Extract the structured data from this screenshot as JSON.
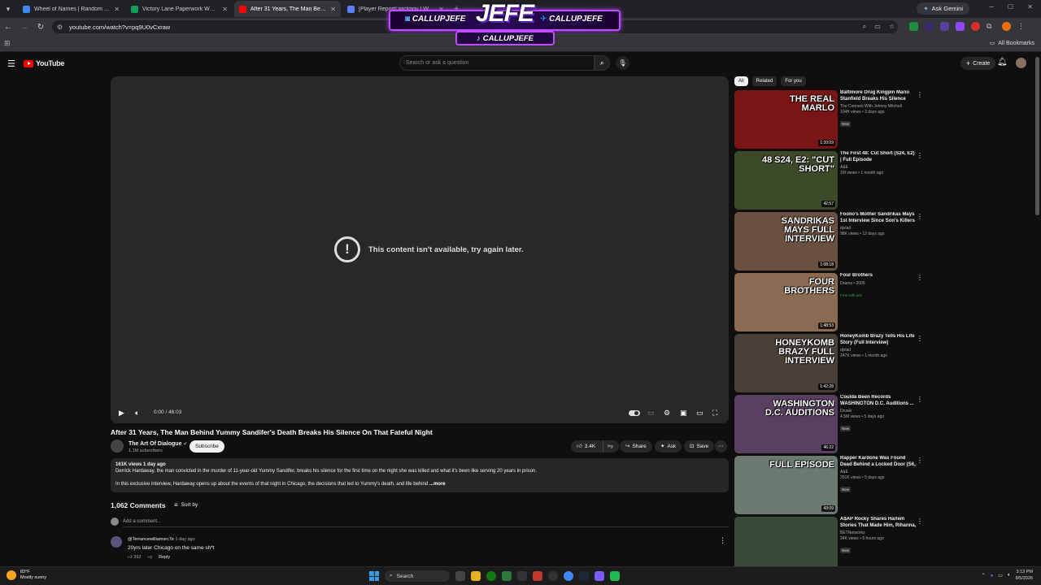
{
  "browser": {
    "tabs": [
      {
        "title": "Wheel of Names | Random name",
        "color": "#4285f4",
        "active": false
      },
      {
        "title": "Victory Lane Paperwork WCRP",
        "color": "#0f9d58",
        "active": false
      },
      {
        "title": "After 31 Years, The Man Behind",
        "color": "#ff0000",
        "active": true
      },
      {
        "title": "[Player Report] wickpov | Windy",
        "color": "#5c7cfa",
        "active": false
      }
    ],
    "new_tab_icon": "+",
    "ask_gemini": "Ask Gemini",
    "url": "youtube.com/watch?v=pq9U0vCxraw",
    "all_bookmarks": "All Bookmarks"
  },
  "overlay": {
    "logo": "JEFE",
    "handle_left": "CALLUPJEFE",
    "handle_right": "CALLUPJEFE",
    "handle_bottom": "CALLUPJEFE"
  },
  "yt_header": {
    "logo_text": "YouTube",
    "search_placeholder": "Search or ask a question",
    "create_label": "Create"
  },
  "player": {
    "error_message": "This content isn't available, try again later.",
    "timecode": "0:00 / 46:03"
  },
  "video": {
    "title": "After 31 Years, The Man Behind Yummy Sandifer's Death Breaks His Silence On That Fateful Night",
    "channel": "The Art Of Dialogue",
    "subscribers": "1.1M subscribers",
    "subscribe_label": "Subscribe",
    "likes": "3.4K",
    "share_label": "Share",
    "ask_label": "Ask",
    "save_label": "Save",
    "meta": "161K views  1 day ago",
    "desc_line1": "Derrick Hardaway, the man convicted in the murder of 11-year-old Yummy Sandifer, breaks his silence for the first time on the night she was killed and what it's been like serving 20 years in prison.",
    "desc_line2": "In this exclusive interview, Hardaway opens up about the events of that night in Chicago, the decisions that led to Yummy's death, and life behind ",
    "more_label": "...more"
  },
  "comments": {
    "count_label": "1,062 Comments",
    "sort_label": "Sort by",
    "add_placeholder": "Add a comment...",
    "items": [
      {
        "author": "@Terrancewilliamsrc7e",
        "ago": "1 day ago",
        "text": "20yrs later Chicago on the same sh*t",
        "likes": "392",
        "reply_label": "Reply"
      }
    ]
  },
  "sidebar": {
    "chips": [
      "All",
      "Related",
      "For you"
    ],
    "recs": [
      {
        "thumb_text": "THE REAL MARLO",
        "thumb_bg": "#7a1515",
        "duration": "1:20:09",
        "title": "Baltimore Drug Kingpin Mario Stanfield Breaks His Silence Abo...",
        "channel": "The Connect With Johnny Mitchell",
        "views": "104K views • 3 days ago",
        "badge": "New"
      },
      {
        "thumb_text": "48 S24, E2: \"CUT SHORT\"",
        "thumb_bg": "#3c4a2a",
        "duration": "42:57",
        "title": "The First 48: Cut Short (S24, E2) | Full Episode",
        "channel": "A&E",
        "views": "1M views • 1 month ago",
        "badge": ""
      },
      {
        "thumb_text": "SANDRIKAS MAYS FULL INTERVIEW",
        "thumb_bg": "#6a5040",
        "duration": "1:08:18",
        "title": "Foolio's Mother Sandrikas Mays 1st Interview Since Son's Killers ...",
        "channel": "djvlad",
        "views": "98K views • 12 days ago",
        "badge": ""
      },
      {
        "thumb_text": "FOUR BROTHERS",
        "thumb_bg": "#8a6a50",
        "duration": "1:48:53",
        "title": "Four Brothers",
        "channel": "Drama • 2005",
        "views": "",
        "badge": "Free with ads"
      },
      {
        "thumb_text": "HONEYKOMB BRAZY FULL INTERVIEW",
        "thumb_bg": "#4a4038",
        "duration": "1:42:28",
        "title": "HoneyKomb Brazy Tells His Life Story (Full Interview)",
        "channel": "djvlad",
        "views": "247K views • 1 month ago",
        "badge": ""
      },
      {
        "thumb_text": "WASHINGTON D.C. AUDITIONS",
        "thumb_bg": "#5a4060",
        "duration": "46:22",
        "title": "Coulda Been Records WASHINGTON D.C. Auditions ...",
        "channel": "Druski",
        "views": "4.5M views • 5 days ago",
        "badge": "New"
      },
      {
        "thumb_text": "FULL EPISODE",
        "thumb_bg": "#6a7a70",
        "duration": "43:09",
        "title": "Rapper Kardone Was Found Dead Behind a Locked Door (S6, E5) | ...",
        "channel": "A&E",
        "views": "251K views • 5 days ago",
        "badge": "New"
      },
      {
        "thumb_text": "",
        "thumb_bg": "#3a4a3a",
        "duration": "",
        "title": "A$AP Rocky Shares Harlem Stories That Made Him, Rihanna, ...",
        "channel": "BETNetworks",
        "views": "34K views • 5 hours ago",
        "badge": "New"
      }
    ]
  },
  "taskbar": {
    "temp": "83°F",
    "condition": "Mostly sunny",
    "search_label": "Search",
    "time": "3:13 PM",
    "date": "8/5/2026"
  }
}
